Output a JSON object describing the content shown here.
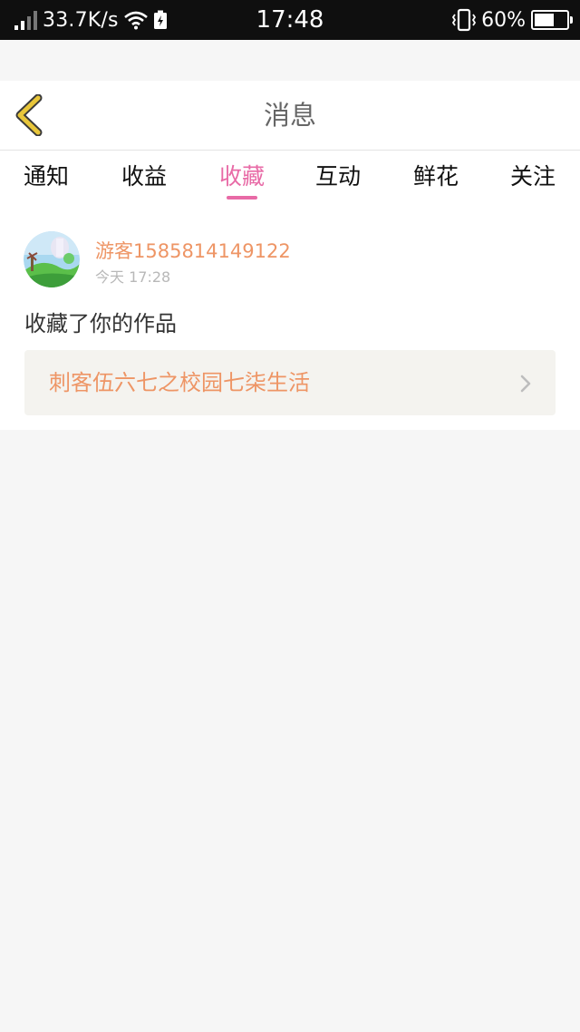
{
  "status_bar": {
    "speed": "33.7K/s",
    "time": "17:48",
    "battery_percent": "60%",
    "battery_level": 0.6
  },
  "header": {
    "title": "消息",
    "back_icon": "chevron-left-icon",
    "back_icon_color": "#e8c63a"
  },
  "tabs": [
    {
      "label": "通知",
      "active": false
    },
    {
      "label": "收益",
      "active": false
    },
    {
      "label": "收藏",
      "active": true
    },
    {
      "label": "互动",
      "active": false
    },
    {
      "label": "鲜花",
      "active": false
    },
    {
      "label": "关注",
      "active": false
    }
  ],
  "message": {
    "username": "游客1585814149122",
    "time": "今天 17:28",
    "action": "收藏了你的作品",
    "work_title": "刺客伍六七之校园七柒生活"
  },
  "colors": {
    "accent": "#e86aa6",
    "link_orange": "#ee9565"
  }
}
